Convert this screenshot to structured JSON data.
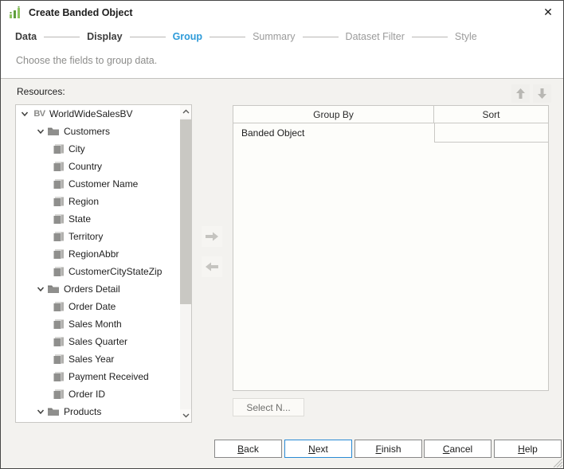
{
  "window": {
    "title": "Create Banded Object",
    "close_glyph": "✕"
  },
  "steps": {
    "items": [
      {
        "label": "Data",
        "state": "visited"
      },
      {
        "label": "Display",
        "state": "visited"
      },
      {
        "label": "Group",
        "state": "current"
      },
      {
        "label": "Summary",
        "state": "upcoming"
      },
      {
        "label": "Dataset Filter",
        "state": "upcoming"
      },
      {
        "label": "Style",
        "state": "upcoming"
      }
    ],
    "subtitle": "Choose the fields to group data."
  },
  "resources": {
    "label": "Resources:",
    "tree": [
      {
        "label": "WorldWideSalesBV",
        "level": 0,
        "icon": "bv",
        "expanded": true
      },
      {
        "label": "Customers",
        "level": 1,
        "icon": "folder",
        "expanded": true
      },
      {
        "label": "City",
        "level": 2,
        "icon": "field"
      },
      {
        "label": "Country",
        "level": 2,
        "icon": "field"
      },
      {
        "label": "Customer Name",
        "level": 2,
        "icon": "field"
      },
      {
        "label": "Region",
        "level": 2,
        "icon": "field"
      },
      {
        "label": "State",
        "level": 2,
        "icon": "field"
      },
      {
        "label": "Territory",
        "level": 2,
        "icon": "field"
      },
      {
        "label": "RegionAbbr",
        "level": 2,
        "icon": "field"
      },
      {
        "label": "CustomerCityStateZip",
        "level": 2,
        "icon": "field"
      },
      {
        "label": "Orders Detail",
        "level": 1,
        "icon": "folder",
        "expanded": true
      },
      {
        "label": "Order Date",
        "level": 2,
        "icon": "field"
      },
      {
        "label": "Sales Month",
        "level": 2,
        "icon": "field"
      },
      {
        "label": "Sales Quarter",
        "level": 2,
        "icon": "field"
      },
      {
        "label": "Sales Year",
        "level": 2,
        "icon": "field"
      },
      {
        "label": "Payment Received",
        "level": 2,
        "icon": "field"
      },
      {
        "label": "Order ID",
        "level": 2,
        "icon": "field"
      },
      {
        "label": "Products",
        "level": 1,
        "icon": "folder",
        "expanded": true
      },
      {
        "label": "",
        "level": 2,
        "icon": "field",
        "partial": true
      }
    ]
  },
  "group_table": {
    "columns": [
      "Group By",
      "Sort"
    ],
    "rows": [
      {
        "group_by": "Banded Object",
        "sort": ""
      }
    ]
  },
  "select_n": {
    "label": "Select N..."
  },
  "footer_buttons": [
    {
      "label": "Back",
      "underline_index": 0,
      "default": false
    },
    {
      "label": "Next",
      "underline_index": 0,
      "default": true
    },
    {
      "label": "Finish",
      "underline_index": 0,
      "default": false
    },
    {
      "label": "Cancel",
      "underline_index": 0,
      "default": false
    },
    {
      "label": "Help",
      "underline_index": 0,
      "default": false
    }
  ],
  "colors": {
    "accent_blue": "#2e9bd9",
    "icon_green_light": "#8cc25d",
    "icon_green_dark": "#5f9e3e",
    "icon_gray": "#8f8f8d",
    "disabled_arrow_gray": "#c5c4c0",
    "body_background": "#f3f2ef"
  }
}
